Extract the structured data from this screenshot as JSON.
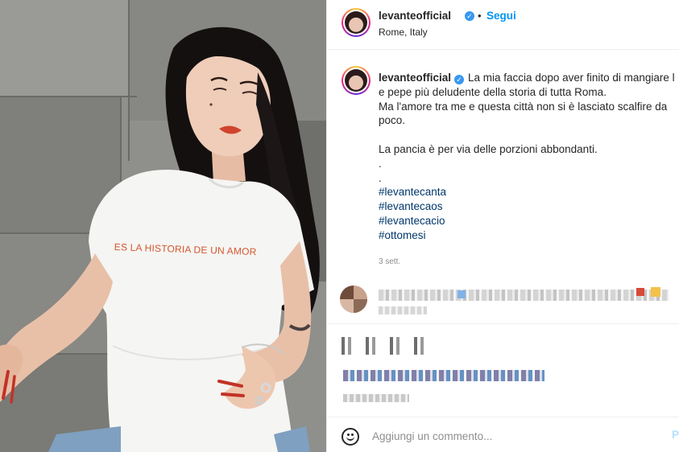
{
  "post": {
    "author": "levanteofficial",
    "verified_icon": "verified-badge-icon",
    "dot": "•",
    "follow_label": "Segui",
    "location": "Rome, Italy",
    "shirt_print": "ES LA HISTORIA DE UN AMOR"
  },
  "caption": {
    "author": "levanteofficial",
    "lines": [
      "La mia faccia dopo aver finito di mangiare l",
      "e pepe più deludente della storia di tutta Roma.",
      "Ma l'amore tra me e questa città non si è lasciato scalfire da",
      "poco.",
      "",
      "La pancia è per via delle porzioni abbondanti.",
      ".",
      "."
    ],
    "hashtags": [
      "#levantecanta",
      "#levantecaos",
      "#levantecacio",
      "#ottomesi"
    ],
    "time": "3 sett."
  },
  "footer": {
    "emoji_icon": "smiley-icon",
    "comment_placeholder": "Aggiungi un commento...",
    "post_label": "Pubblica"
  },
  "colors": {
    "link_blue": "#0095f6",
    "hashtag": "#00376b",
    "verified": "#3897f0",
    "secondary_text": "#8e8e8e",
    "divider": "#efefef"
  }
}
